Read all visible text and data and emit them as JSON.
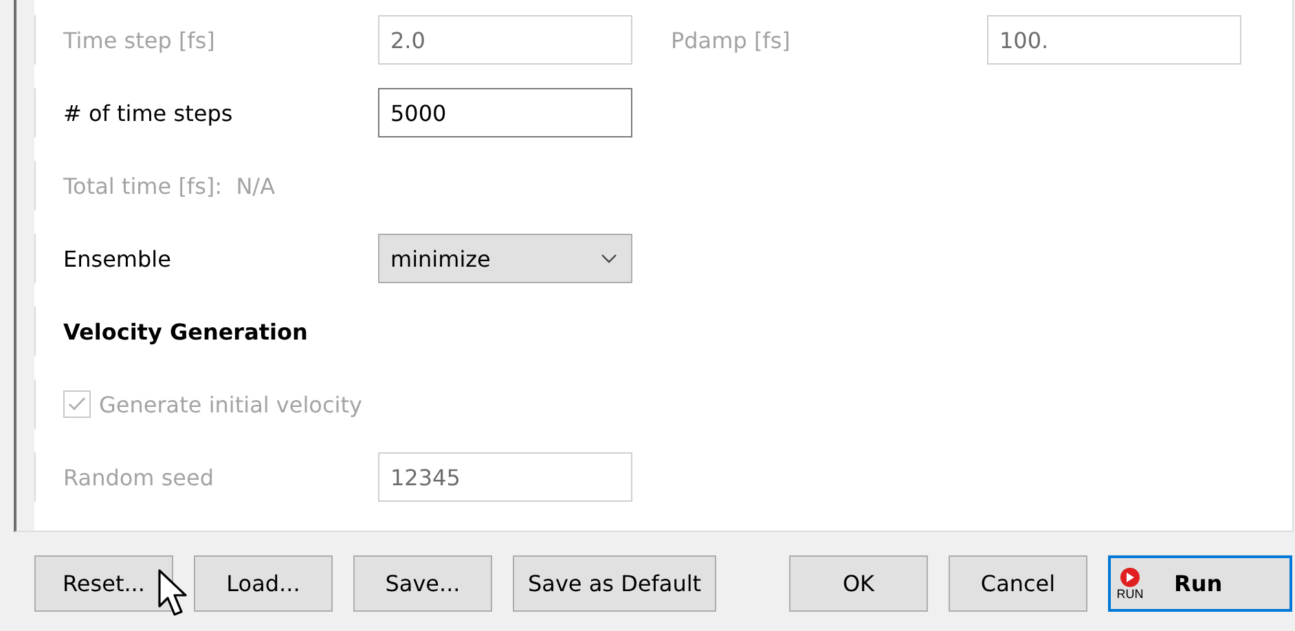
{
  "form": {
    "rows": [
      {
        "kind": "field",
        "label": "Time step [fs]",
        "value": "2.0",
        "disabled": true,
        "side": {
          "label": "Pdamp [fs]",
          "value": "100.",
          "disabled": true
        }
      },
      {
        "kind": "field",
        "label": "# of time steps",
        "value": "5000",
        "disabled": false
      },
      {
        "kind": "info",
        "label": "Total time [fs]:",
        "value": "N/A",
        "disabled": true
      },
      {
        "kind": "select",
        "label": "Ensemble",
        "value": "minimize",
        "disabled": false
      },
      {
        "kind": "heading",
        "label": "Velocity Generation"
      },
      {
        "kind": "checkbox",
        "label": "Generate initial velocity",
        "checked": true,
        "disabled": true
      },
      {
        "kind": "field",
        "label": "Random seed",
        "value": "12345",
        "disabled": true
      }
    ]
  },
  "buttons_left": [
    {
      "label": "Reset...",
      "default": false
    },
    {
      "label": "Load...",
      "default": false
    },
    {
      "label": "Save...",
      "default": false
    },
    {
      "label": "Save as Default",
      "default": false
    }
  ],
  "buttons_right": [
    {
      "label": "OK",
      "default": false
    },
    {
      "label": "Cancel",
      "default": false
    },
    {
      "label": "Run",
      "default": true,
      "icon_text": "RUN"
    }
  ]
}
